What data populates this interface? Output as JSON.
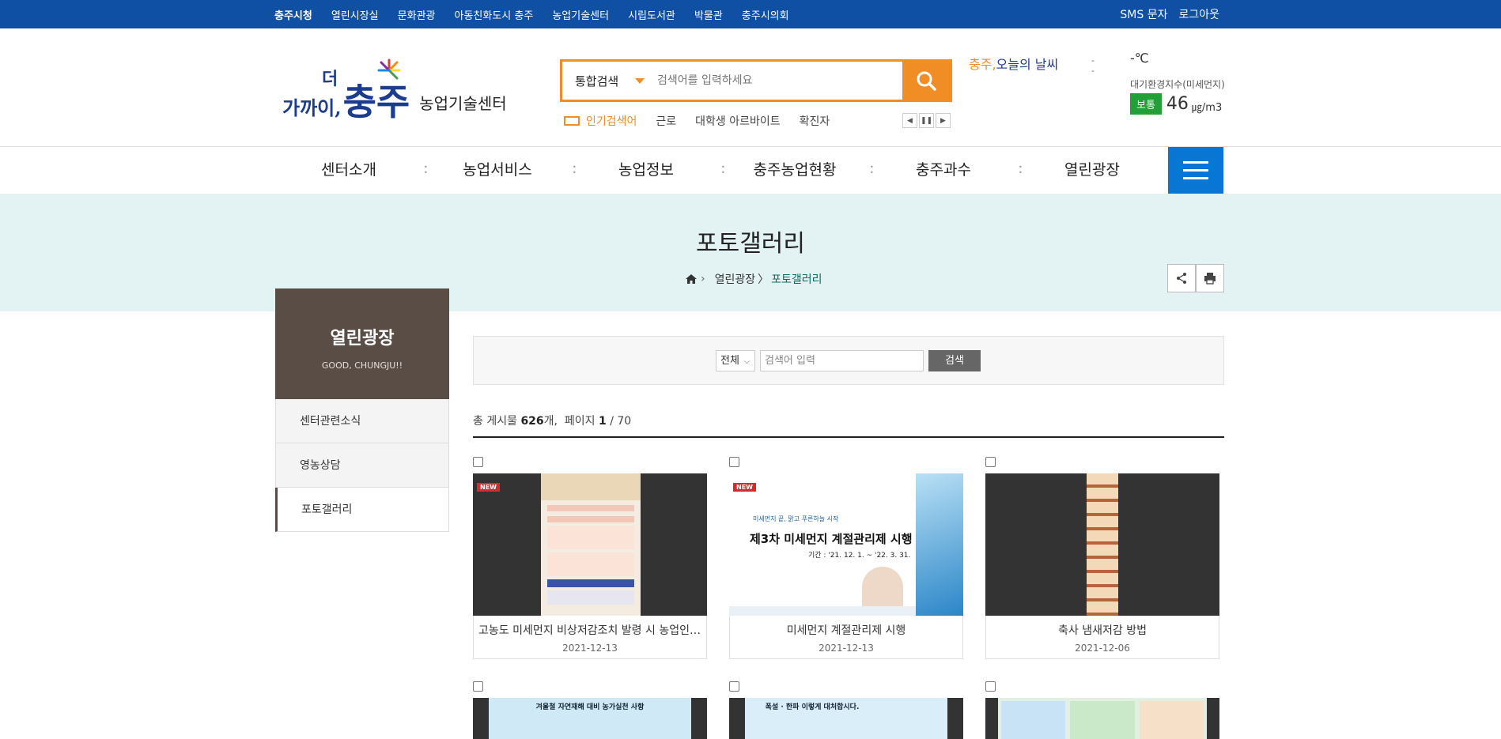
{
  "topbar": {
    "links": [
      "충주시청",
      "열린시장실",
      "문화관광",
      "아동친화도시 충주",
      "농업기술센터",
      "시립도서관",
      "박물관",
      "충주시의회"
    ],
    "sms": "SMS 문자",
    "logout": "로그아웃"
  },
  "logo": {
    "slogan_a": "가까이,",
    "slogan_b": "더",
    "city": "충주",
    "center": "농업기술센터"
  },
  "search": {
    "category": "통합검색",
    "placeholder": "검색어를 입력하세요"
  },
  "popular": {
    "label": "인기검색어",
    "keywords": [
      "근로",
      "대학생 아르바이트",
      "확진자"
    ]
  },
  "weather": {
    "city": "충주,",
    "rest": "오늘의 날씨",
    "img_alt": "-",
    "img_alt2": "-",
    "temp": "-℃",
    "air_label": "대기환경지수(미세먼지)",
    "air_status": "보통",
    "air_value": "46",
    "air_unit": "㎍/m3"
  },
  "nav": [
    "센터소개",
    "농업서비스",
    "농업정보",
    "충주농업현황",
    "충주과수",
    "열린광장"
  ],
  "banner": {
    "title": "포토갤러리",
    "crumb_parent": "열린광장",
    "crumb_sep": "〉",
    "crumb_current": "포토갤러리"
  },
  "side": {
    "title": "열린광장",
    "subtitle": "GOOD, CHUNGJU!!",
    "items": [
      "센터관련소식",
      "영농상담",
      "포토갤러리"
    ]
  },
  "board_search": {
    "scope": "전체",
    "placeholder": "검색어 입력",
    "button": "검색"
  },
  "count": {
    "prefix": "총 게시물",
    "total": "626",
    "suffix": "개,",
    "page_label": "페이지",
    "page": "1",
    "pages": "/ 70"
  },
  "cards": [
    {
      "title": "고농도 미세먼지 비상저감조치 발령 시 농업인 행동요령",
      "date": "2021-12-13",
      "new": "NEW"
    },
    {
      "title": "미세먼지 계절관리제 시행",
      "date": "2021-12-13",
      "new": "NEW"
    },
    {
      "title": "축사 냄새저감 방법",
      "date": "2021-12-06",
      "new": ""
    }
  ],
  "thumbs": {
    "card2_line1": "미세먼지 끝, 맑고 푸른하늘 시작",
    "card2_line2": "제3차 미세먼지 계절관리제 시행",
    "card2_line3": "기간 : '21. 12. 1. ~ '22. 3. 31.",
    "card4_head": "겨울철 자연재해 대비 농가실천 사항",
    "card5_head": "폭설 · 한파 이렇게 대처합시다."
  },
  "colors": {
    "topbar": "#0f4fa4",
    "accent": "#f08d24",
    "menu": "#0a76d4",
    "banner": "#e3f2f3",
    "side_head": "#5a4d46",
    "air_good": "#21a038"
  }
}
